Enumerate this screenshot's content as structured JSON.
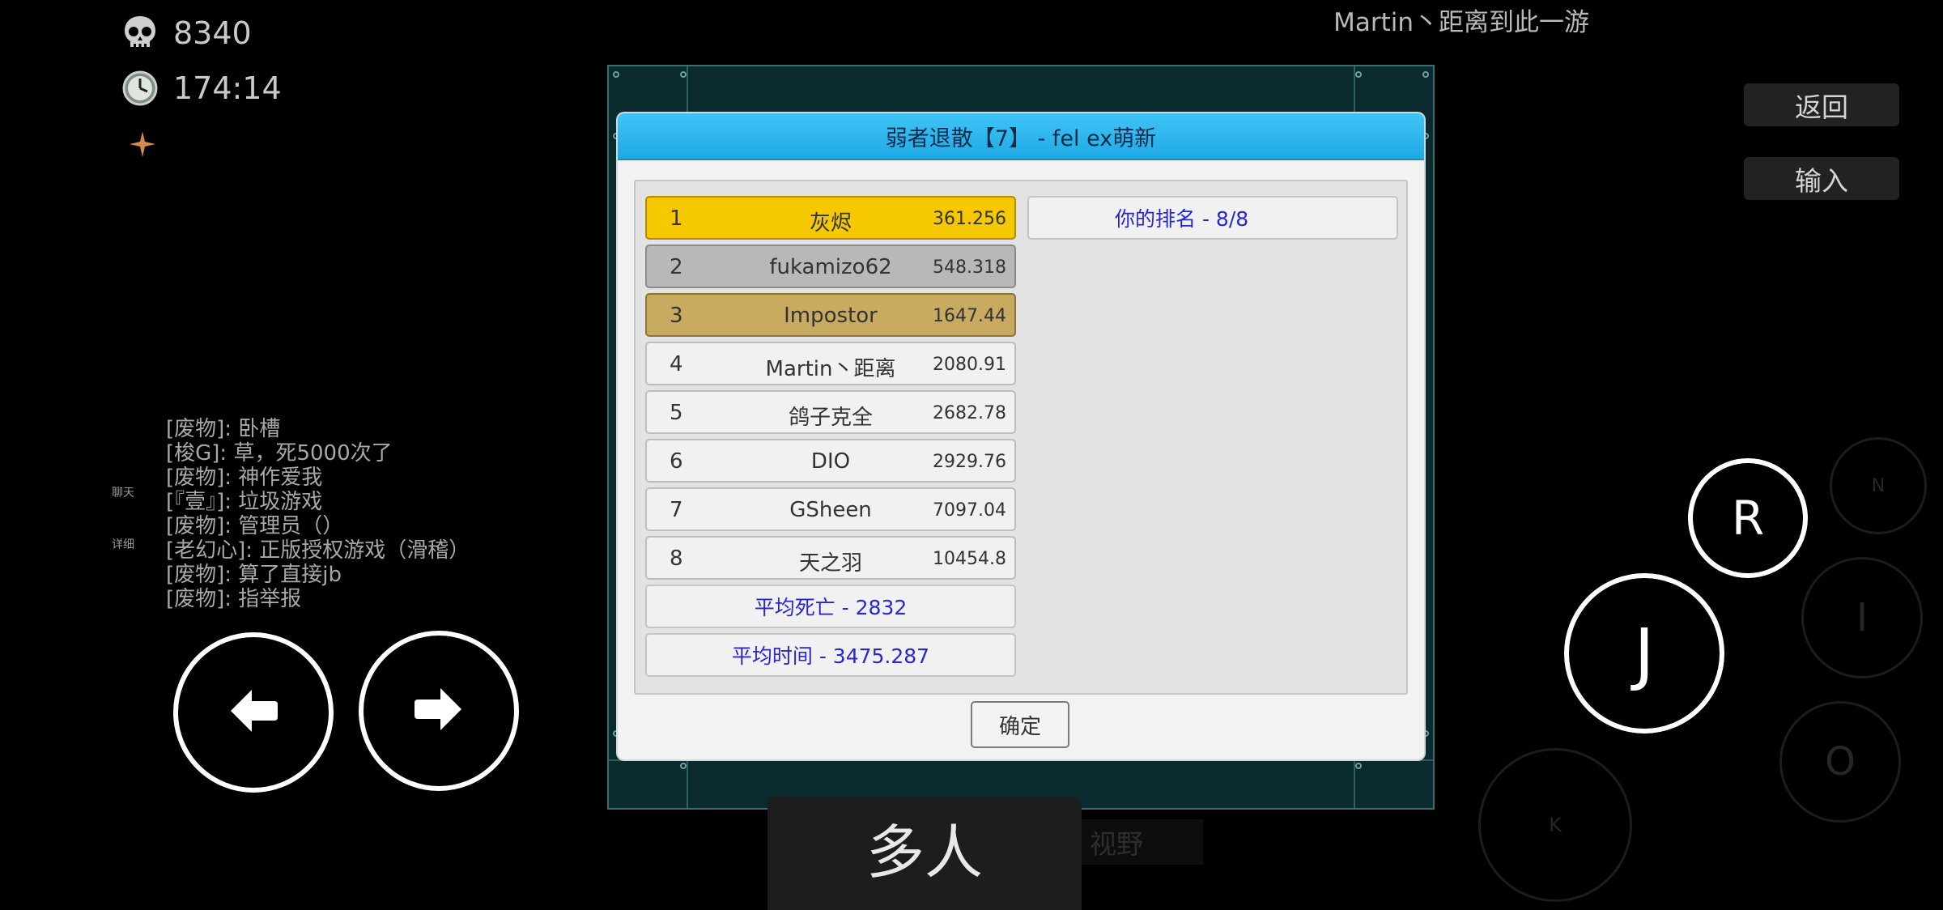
{
  "hud": {
    "deaths": "8340",
    "time": "174:14"
  },
  "notice": "Martin丶距离到此一游",
  "side_buttons": {
    "back": "返回",
    "input": "输入"
  },
  "chat": {
    "tabs": [
      "聊天",
      "详细"
    ],
    "messages": [
      "[废物]: 卧槽",
      "[梭G]: 草，死5000次了",
      "[废物]: 神作爱我",
      "[『壹』]: 垃圾游戏",
      "[废物]: 管理员（）",
      "[老幻心]: 正版授权游戏（滑稽）",
      "[废物]: 算了直接jb",
      "[废物]: 指举报"
    ]
  },
  "controls": {
    "r": "R",
    "j": "J",
    "n": "N",
    "i": "I",
    "o": "O",
    "k": "K"
  },
  "bottom": {
    "multiplayer": "多人",
    "view": "视野"
  },
  "dialog": {
    "title": "弱者退散【7】 - fel ex萌新",
    "ranking": [
      {
        "pos": "1",
        "name": "灰烬",
        "score": "361.256"
      },
      {
        "pos": "2",
        "name": "fukamizo62",
        "score": "548.318"
      },
      {
        "pos": "3",
        "name": "Impostor",
        "score": "1647.44"
      },
      {
        "pos": "4",
        "name": "Martin丶距离",
        "score": "2080.91"
      },
      {
        "pos": "5",
        "name": "鸽子克全",
        "score": "2682.78"
      },
      {
        "pos": "6",
        "name": "DIO",
        "score": "2929.76"
      },
      {
        "pos": "7",
        "name": "GSheen",
        "score": "7097.04"
      },
      {
        "pos": "8",
        "name": "天之羽",
        "score": "10454.8"
      }
    ],
    "avg_deaths": "平均死亡 - 2832",
    "avg_time": "平均时间 - 3475.287",
    "your_rank": "你的排名 - 8/8",
    "ok": "确定"
  },
  "colors": {
    "gold": "#f5c800",
    "silver": "#b8b8b8",
    "bronze": "#c8aa60",
    "title_bar": "#2bb6ee",
    "summary_text": "#2727d0"
  }
}
